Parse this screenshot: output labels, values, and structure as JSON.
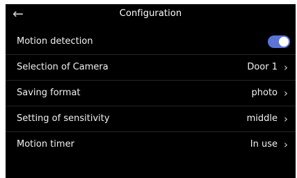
{
  "header": {
    "title": "Configuration",
    "back_icon": "←"
  },
  "rows": [
    {
      "label": "Motion detection",
      "toggle_on": true
    },
    {
      "label": "Selection of Camera",
      "value": "Door 1"
    },
    {
      "label": "Saving format",
      "value": "photo"
    },
    {
      "label": "Setting of sensitivity",
      "value": "middle"
    },
    {
      "label": "Motion timer",
      "value": "In use"
    }
  ],
  "chevron_icon": "›",
  "colors": {
    "background": "#000000",
    "toggle_on": "#5b74d6",
    "divider": "#262626"
  }
}
